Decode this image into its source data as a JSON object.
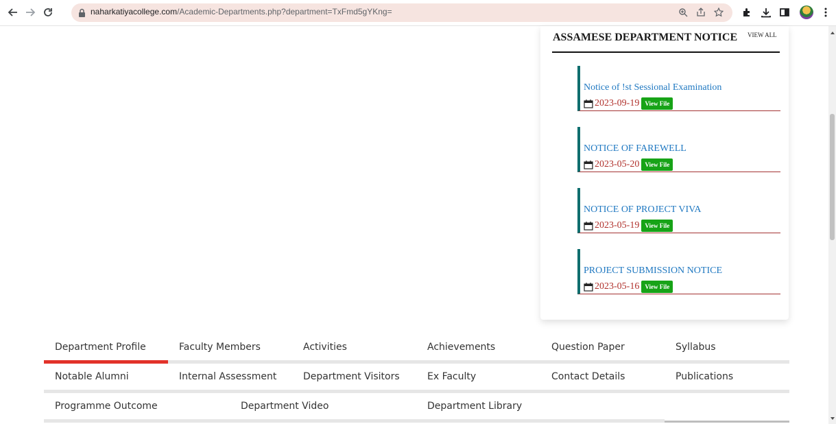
{
  "browser": {
    "url_domain": "naharkatiyacollege.com",
    "url_path": "/Academic-Departments.php?department=TxFmd5gYKng=",
    "icons": [
      "back-icon",
      "forward-icon",
      "reload-icon",
      "lock-icon",
      "zoom-icon",
      "share-icon",
      "star-icon",
      "extensions-icon",
      "download-icon",
      "sidebar-icon",
      "profile-icon",
      "menu-icon"
    ]
  },
  "notice_panel": {
    "heading": "ASSAMESE DEPARTMENT NOTICE",
    "view_all": "VIEW ALL",
    "notices": [
      {
        "title": "Notice of !st Sessional Examination",
        "date": "2023-09-19",
        "button": "View File"
      },
      {
        "title": "NOTICE OF FAREWELL",
        "date": "2023-05-20",
        "button": "View File"
      },
      {
        "title": "NOTICE OF PROJECT VIVA",
        "date": "2023-05-19",
        "button": "View File"
      },
      {
        "title": "PROJECT SUBMISSION NOTICE",
        "date": "2023-05-16",
        "button": "View File"
      }
    ]
  },
  "tabs": {
    "row1": [
      "Department Profile",
      "Faculty Members",
      "Activities",
      "Achievements",
      "Question Paper",
      "Syllabus"
    ],
    "row2": [
      "Notable Alumni",
      "Internal Assessment",
      "Department Visitors",
      "Ex Faculty",
      "Contact Details",
      "Publications"
    ],
    "row3": [
      "Programme Outcome",
      "Department Video",
      "Department Library"
    ],
    "active": "Department Profile"
  },
  "colors": {
    "tab_active": "#e2322a",
    "notice_border": "#0f6e6e",
    "notice_title": "#1f78c1",
    "notice_date": "#b0302b",
    "view_file_bg": "#17a317"
  }
}
